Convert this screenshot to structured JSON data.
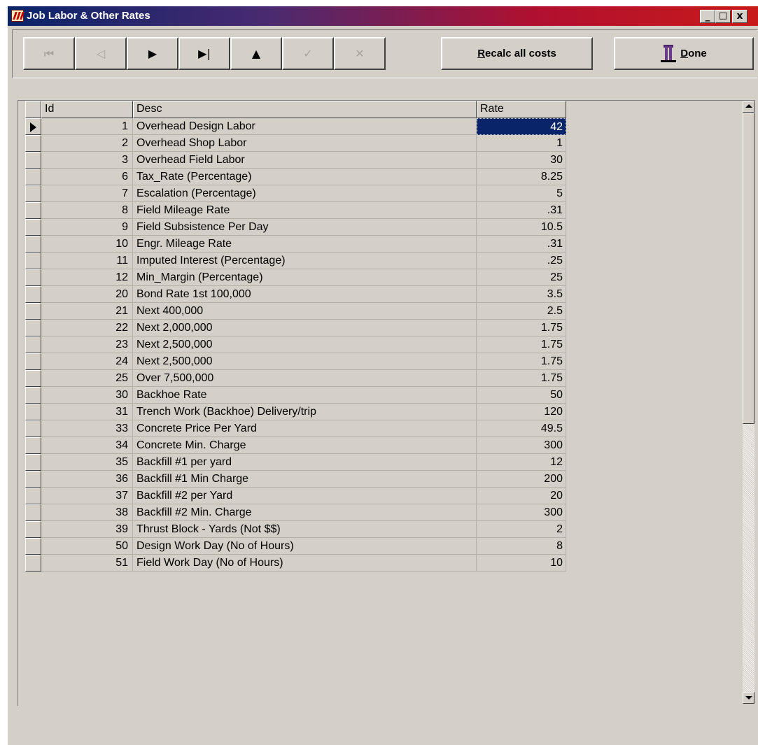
{
  "window": {
    "title": "Job Labor & Other Rates",
    "caption_buttons": {
      "minimize": "_",
      "maximize": "□",
      "close": "x"
    }
  },
  "toolbar": {
    "nav_buttons": [
      {
        "name": "first-record-button",
        "glyph": "⏮",
        "enabled": false
      },
      {
        "name": "prior-record-button",
        "glyph": "◁",
        "enabled": false
      },
      {
        "name": "next-record-button",
        "glyph": "▶",
        "enabled": true
      },
      {
        "name": "last-record-button",
        "glyph": "▶|",
        "enabled": true
      },
      {
        "name": "insert-record-button",
        "glyph": "▲",
        "enabled": true
      },
      {
        "name": "post-edit-button",
        "glyph": "✓",
        "enabled": false
      },
      {
        "name": "cancel-edit-button",
        "glyph": "✕",
        "enabled": false
      }
    ],
    "recalc": {
      "accel": "R",
      "rest": "ecalc all costs"
    },
    "done": {
      "accel": "D",
      "rest": "one"
    }
  },
  "grid": {
    "columns": [
      "Id",
      "Desc",
      "Rate"
    ],
    "selected_row": 0,
    "rows": [
      {
        "id": "1",
        "desc": "Overhead Design Labor",
        "rate": "42"
      },
      {
        "id": "2",
        "desc": "Overhead Shop Labor",
        "rate": "1"
      },
      {
        "id": "3",
        "desc": "Overhead Field Labor",
        "rate": "30"
      },
      {
        "id": "6",
        "desc": "Tax_Rate (Percentage)",
        "rate": "8.25"
      },
      {
        "id": "7",
        "desc": "Escalation (Percentage)",
        "rate": "5"
      },
      {
        "id": "8",
        "desc": "Field Mileage Rate",
        "rate": ".31"
      },
      {
        "id": "9",
        "desc": "Field Subsistence Per Day",
        "rate": "10.5"
      },
      {
        "id": "10",
        "desc": "Engr. Mileage Rate",
        "rate": ".31"
      },
      {
        "id": "11",
        "desc": "Imputed Interest (Percentage)",
        "rate": ".25"
      },
      {
        "id": "12",
        "desc": "Min_Margin (Percentage)",
        "rate": "25"
      },
      {
        "id": "20",
        "desc": "Bond Rate 1st 100,000",
        "rate": "3.5"
      },
      {
        "id": "21",
        "desc": "Next 400,000",
        "rate": "2.5"
      },
      {
        "id": "22",
        "desc": "Next 2,000,000",
        "rate": "1.75"
      },
      {
        "id": "23",
        "desc": "Next 2,500,000",
        "rate": "1.75"
      },
      {
        "id": "24",
        "desc": "Next 2,500,000",
        "rate": "1.75"
      },
      {
        "id": "25",
        "desc": "Over 7,500,000",
        "rate": "1.75"
      },
      {
        "id": "30",
        "desc": "Backhoe Rate",
        "rate": "50"
      },
      {
        "id": "31",
        "desc": "Trench Work (Backhoe) Delivery/trip",
        "rate": "120"
      },
      {
        "id": "33",
        "desc": "Concrete Price Per Yard",
        "rate": "49.5"
      },
      {
        "id": "34",
        "desc": "Concrete Min. Charge",
        "rate": "300"
      },
      {
        "id": "35",
        "desc": "Backfill #1 per yard",
        "rate": "12"
      },
      {
        "id": "36",
        "desc": "Backfill  #1 Min Charge",
        "rate": "200"
      },
      {
        "id": "37",
        "desc": "Backfill #2 per Yard",
        "rate": "20"
      },
      {
        "id": "38",
        "desc": "Backfill #2 Min. Charge",
        "rate": "300"
      },
      {
        "id": "39",
        "desc": "Thrust Block - Yards (Not $$)",
        "rate": "2"
      },
      {
        "id": "50",
        "desc": "Design Work Day (No of Hours)",
        "rate": "8"
      },
      {
        "id": "51",
        "desc": "Field Work Day (No of Hours)",
        "rate": "10"
      }
    ]
  }
}
